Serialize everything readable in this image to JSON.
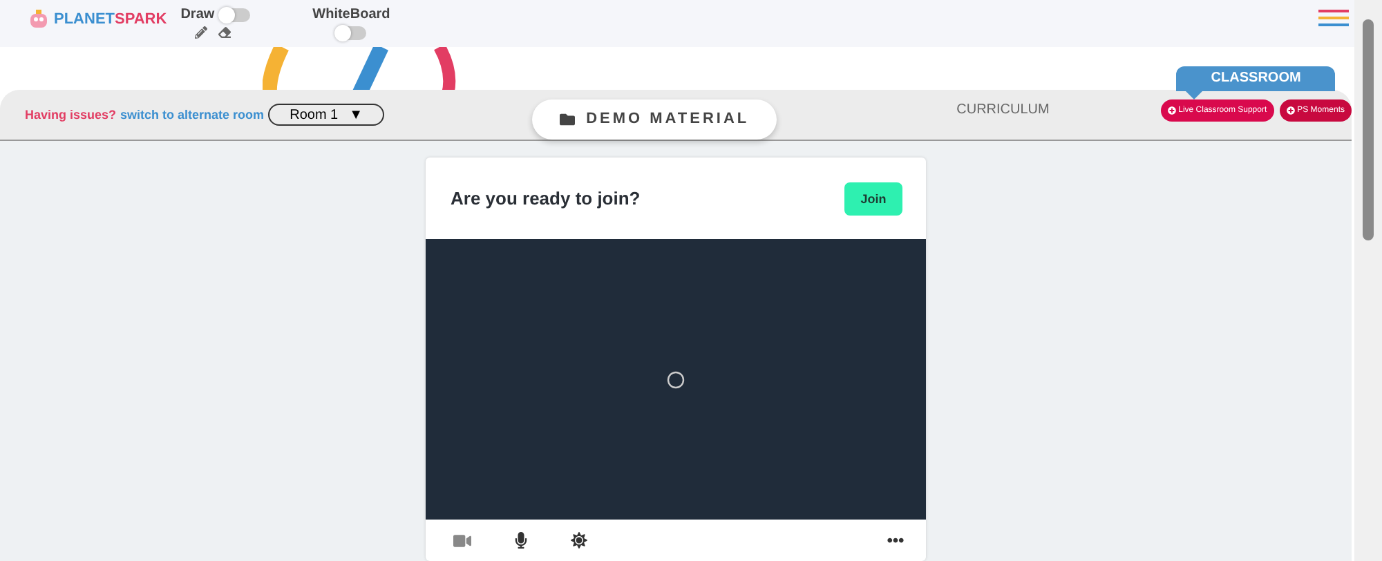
{
  "header": {
    "logo": {
      "word_1": "PLANET",
      "word_2": "SPARK"
    },
    "draw": {
      "label": "Draw",
      "on": false
    },
    "whiteboard": {
      "label": "WhiteBoard",
      "on": false
    }
  },
  "toolbar": {
    "issue_text": "Having issues?",
    "switch_link": "switch to alternate room",
    "room_select": {
      "value": "Room 1",
      "caret": "▼"
    }
  },
  "tabs": [
    {
      "label": "DEMO MATERIAL",
      "selected": true
    },
    {
      "label": "CURRICULUM",
      "selected": false
    }
  ],
  "classroom": {
    "label": "CLASSROOM",
    "buttons": [
      "Live Classroom Support",
      "PS Moments"
    ]
  },
  "join_card": {
    "title": "Are you ready to join?",
    "button": "Join"
  }
}
